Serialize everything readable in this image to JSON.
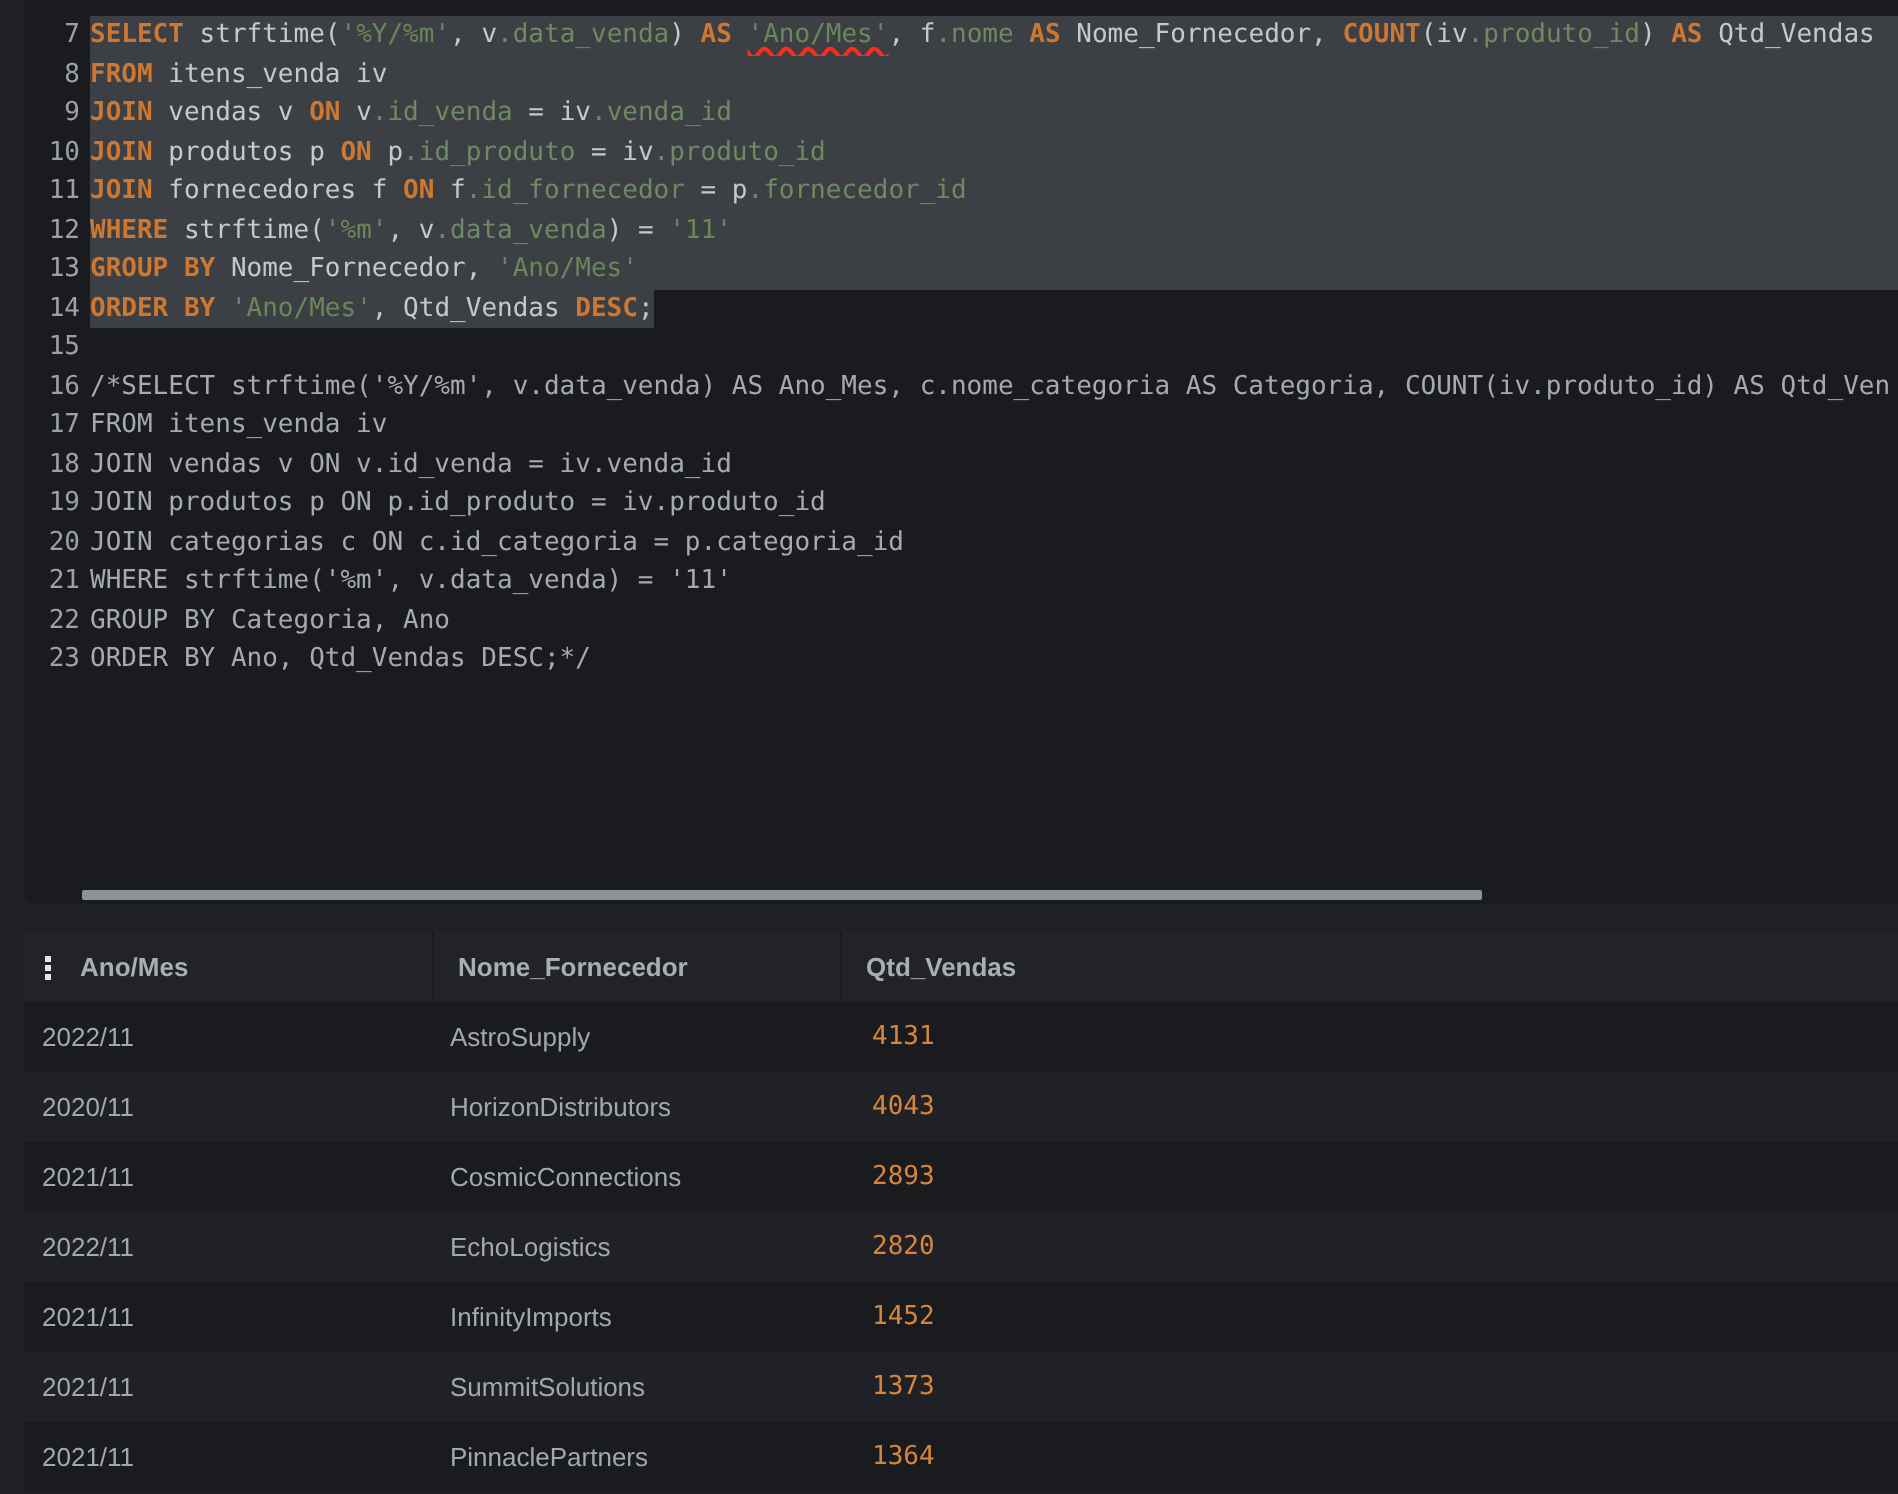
{
  "editor": {
    "lines": [
      {
        "number": "7",
        "selected": true,
        "tokens": [
          {
            "kind": "keyword",
            "text": "SELECT",
            "misspelled": false
          },
          {
            "kind": "plain",
            "text": " strftime(",
            "misspelled": false
          },
          {
            "kind": "string",
            "text": "'%Y/%m'",
            "misspelled": false
          },
          {
            "kind": "plain",
            "text": ", v",
            "misspelled": false
          },
          {
            "kind": "field",
            "text": ".data_venda",
            "misspelled": false
          },
          {
            "kind": "plain",
            "text": ") ",
            "misspelled": false
          },
          {
            "kind": "keyword",
            "text": "AS ",
            "misspelled": false
          },
          {
            "kind": "string",
            "text": "'Ano/Mes'",
            "misspelled": true
          },
          {
            "kind": "plain",
            "text": ", f",
            "misspelled": false
          },
          {
            "kind": "field",
            "text": ".nome ",
            "misspelled": false
          },
          {
            "kind": "keyword",
            "text": "AS",
            "misspelled": false
          },
          {
            "kind": "plain",
            "text": " Nome_Fornecedor, ",
            "misspelled": false
          },
          {
            "kind": "keyword",
            "text": "COUNT",
            "misspelled": false
          },
          {
            "kind": "plain",
            "text": "(iv",
            "misspelled": false
          },
          {
            "kind": "field",
            "text": ".produto_id",
            "misspelled": false
          },
          {
            "kind": "plain",
            "text": ") ",
            "misspelled": false
          },
          {
            "kind": "keyword",
            "text": "AS",
            "misspelled": false
          },
          {
            "kind": "plain",
            "text": " Qtd_Vendas",
            "misspelled": false
          }
        ]
      },
      {
        "number": "8",
        "selected": true,
        "tokens": [
          {
            "kind": "keyword",
            "text": "FROM",
            "misspelled": false
          },
          {
            "kind": "plain",
            "text": " itens_venda iv",
            "misspelled": false
          }
        ]
      },
      {
        "number": "9",
        "selected": true,
        "tokens": [
          {
            "kind": "keyword",
            "text": "JOIN",
            "misspelled": false
          },
          {
            "kind": "plain",
            "text": " vendas v ",
            "misspelled": false
          },
          {
            "kind": "keyword",
            "text": "ON",
            "misspelled": false
          },
          {
            "kind": "plain",
            "text": " v",
            "misspelled": false
          },
          {
            "kind": "field",
            "text": ".id_venda",
            "misspelled": false
          },
          {
            "kind": "plain",
            "text": " = iv",
            "misspelled": false
          },
          {
            "kind": "field",
            "text": ".venda_id",
            "misspelled": false
          }
        ]
      },
      {
        "number": "10",
        "selected": true,
        "tokens": [
          {
            "kind": "keyword",
            "text": "JOIN",
            "misspelled": false
          },
          {
            "kind": "plain",
            "text": " produtos p ",
            "misspelled": false
          },
          {
            "kind": "keyword",
            "text": "ON",
            "misspelled": false
          },
          {
            "kind": "plain",
            "text": " p",
            "misspelled": false
          },
          {
            "kind": "field",
            "text": ".id_produto",
            "misspelled": false
          },
          {
            "kind": "plain",
            "text": " = iv",
            "misspelled": false
          },
          {
            "kind": "field",
            "text": ".produto_id",
            "misspelled": false
          }
        ]
      },
      {
        "number": "11",
        "selected": true,
        "tokens": [
          {
            "kind": "keyword",
            "text": "JOIN",
            "misspelled": false
          },
          {
            "kind": "plain",
            "text": " fornecedores f ",
            "misspelled": false
          },
          {
            "kind": "keyword",
            "text": "ON",
            "misspelled": false
          },
          {
            "kind": "plain",
            "text": " f",
            "misspelled": false
          },
          {
            "kind": "field",
            "text": ".id_fornecedor",
            "misspelled": false
          },
          {
            "kind": "plain",
            "text": " = p",
            "misspelled": false
          },
          {
            "kind": "field",
            "text": ".fornecedor_id",
            "misspelled": false
          }
        ]
      },
      {
        "number": "12",
        "selected": true,
        "tokens": [
          {
            "kind": "keyword",
            "text": "WHERE",
            "misspelled": false
          },
          {
            "kind": "plain",
            "text": " strftime(",
            "misspelled": false
          },
          {
            "kind": "string",
            "text": "'%m'",
            "misspelled": false
          },
          {
            "kind": "plain",
            "text": ", v",
            "misspelled": false
          },
          {
            "kind": "field",
            "text": ".data_venda",
            "misspelled": false
          },
          {
            "kind": "plain",
            "text": ") = ",
            "misspelled": false
          },
          {
            "kind": "string",
            "text": "'11'",
            "misspelled": false
          }
        ]
      },
      {
        "number": "13",
        "selected": true,
        "tokens": [
          {
            "kind": "keyword",
            "text": "GROUP BY",
            "misspelled": false
          },
          {
            "kind": "plain",
            "text": " Nome_Fornecedor, ",
            "misspelled": false
          },
          {
            "kind": "string",
            "text": "'Ano/Mes'",
            "misspelled": false
          }
        ]
      },
      {
        "number": "14",
        "selected": true,
        "tokens": [
          {
            "kind": "keyword",
            "text": "ORDER BY ",
            "misspelled": false
          },
          {
            "kind": "string",
            "text": "'Ano/Mes'",
            "misspelled": false
          },
          {
            "kind": "plain",
            "text": ", Qtd_Vendas ",
            "misspelled": false
          },
          {
            "kind": "keyword",
            "text": "DESC",
            "misspelled": false
          },
          {
            "kind": "plain",
            "text": ";",
            "misspelled": false
          }
        ]
      },
      {
        "number": "15",
        "selected": false
      },
      {
        "number": "16",
        "selected": false,
        "tokens": [
          {
            "kind": "comment",
            "text": "/*SELECT strftime('%Y/%m', v.data_venda) AS Ano_Mes, c.nome_categoria AS Categoria, COUNT(iv.produto_id) AS Qtd_Ven",
            "misspelled": false
          }
        ]
      },
      {
        "number": "17",
        "selected": false,
        "tokens": [
          {
            "kind": "comment",
            "text": "FROM itens_venda iv",
            "misspelled": false
          }
        ]
      },
      {
        "number": "18",
        "selected": false,
        "tokens": [
          {
            "kind": "comment",
            "text": "JOIN vendas v ON v.id_venda = iv.venda_id",
            "misspelled": false
          }
        ]
      },
      {
        "number": "19",
        "selected": false,
        "tokens": [
          {
            "kind": "comment",
            "text": "JOIN produtos p ON p.id_produto = iv.produto_id",
            "misspelled": false
          }
        ]
      },
      {
        "number": "20",
        "selected": false,
        "tokens": [
          {
            "kind": "comment",
            "text": "JOIN categorias c ON c.id_categoria = p.categoria_id",
            "misspelled": false
          }
        ]
      },
      {
        "number": "21",
        "selected": false,
        "tokens": [
          {
            "kind": "comment",
            "text": "WHERE strftime('%m', v.data_venda) = '11'",
            "misspelled": false
          }
        ]
      },
      {
        "number": "22",
        "selected": false,
        "tokens": [
          {
            "kind": "comment",
            "text": "GROUP BY Categoria, Ano",
            "misspelled": false
          }
        ]
      },
      {
        "number": "23",
        "selected": false,
        "tokens": [
          {
            "kind": "comment",
            "text": "ORDER BY Ano, Qtd_Vendas DESC;*/",
            "misspelled": false
          }
        ]
      }
    ]
  },
  "results": {
    "columns": [
      {
        "label": "Ano/Mes",
        "kind": "text",
        "menu_icon": true
      },
      {
        "label": "Nome_Fornecedor",
        "kind": "text",
        "menu_icon": false
      },
      {
        "label": "Qtd_Vendas",
        "kind": "number",
        "menu_icon": false
      }
    ],
    "rows": [
      [
        "2022/11",
        "AstroSupply",
        "4131"
      ],
      [
        "2020/11",
        "HorizonDistributors",
        "4043"
      ],
      [
        "2021/11",
        "CosmicConnections",
        "2893"
      ],
      [
        "2022/11",
        "EchoLogistics",
        "2820"
      ],
      [
        "2021/11",
        "InfinityImports",
        "1452"
      ],
      [
        "2021/11",
        "SummitSolutions",
        "1373"
      ],
      [
        "2021/11",
        "PinnaclePartners",
        "1364"
      ]
    ]
  }
}
